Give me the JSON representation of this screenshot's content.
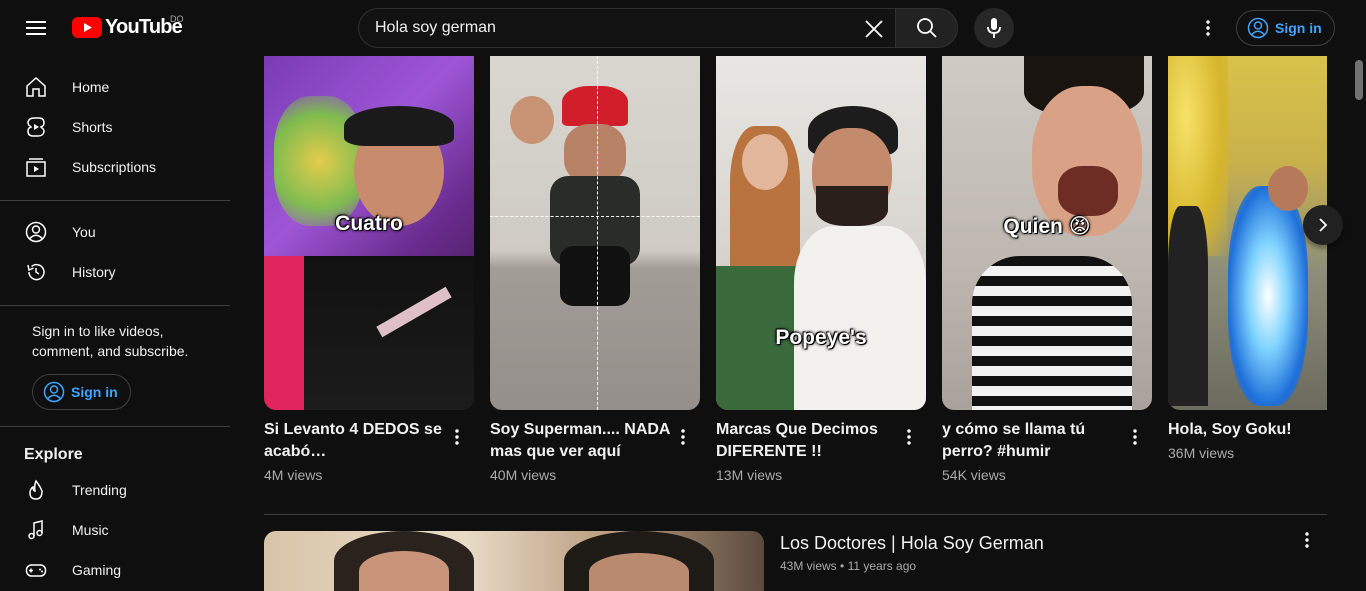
{
  "header": {
    "logo_text": "YouTube",
    "country_code": "DO",
    "search_value": "Hola soy german",
    "signin_label": "Sign in"
  },
  "sidebar": {
    "items": [
      {
        "label": "Home",
        "icon": "home-icon"
      },
      {
        "label": "Shorts",
        "icon": "shorts-icon"
      },
      {
        "label": "Subscriptions",
        "icon": "subscriptions-icon"
      },
      {
        "label": "You",
        "icon": "you-icon"
      },
      {
        "label": "History",
        "icon": "history-icon"
      }
    ],
    "signin_prompt": "Sign in to like videos, comment, and subscribe.",
    "signin_label": "Sign in",
    "explore_heading": "Explore",
    "explore_items": [
      {
        "label": "Trending",
        "icon": "trending-icon"
      },
      {
        "label": "Music",
        "icon": "music-icon"
      },
      {
        "label": "Gaming",
        "icon": "gaming-icon"
      }
    ]
  },
  "shorts": [
    {
      "title": "Si Levanto 4 DEDOS se acabó…",
      "views": "4M views",
      "caption": "Cuatro"
    },
    {
      "title": "Soy Superman.... NADA mas que ver aquí",
      "views": "40M views",
      "caption": ""
    },
    {
      "title": "Marcas Que Decimos DIFERENTE !!",
      "views": "13M views",
      "caption": "Popeye's"
    },
    {
      "title": "y cómo se llama tú perro? #humir #germa…",
      "views": "54K views",
      "caption": "Quien 😡"
    },
    {
      "title": "Hola, Soy Goku!",
      "views": "36M views",
      "caption": ""
    }
  ],
  "video": {
    "title": "Los Doctores | Hola Soy German",
    "views": "43M views",
    "age": "11 years ago",
    "separator": "•"
  },
  "colors": {
    "background": "#0f0f0f",
    "accent_red": "#ff0000",
    "link_blue": "#3ea6ff"
  }
}
